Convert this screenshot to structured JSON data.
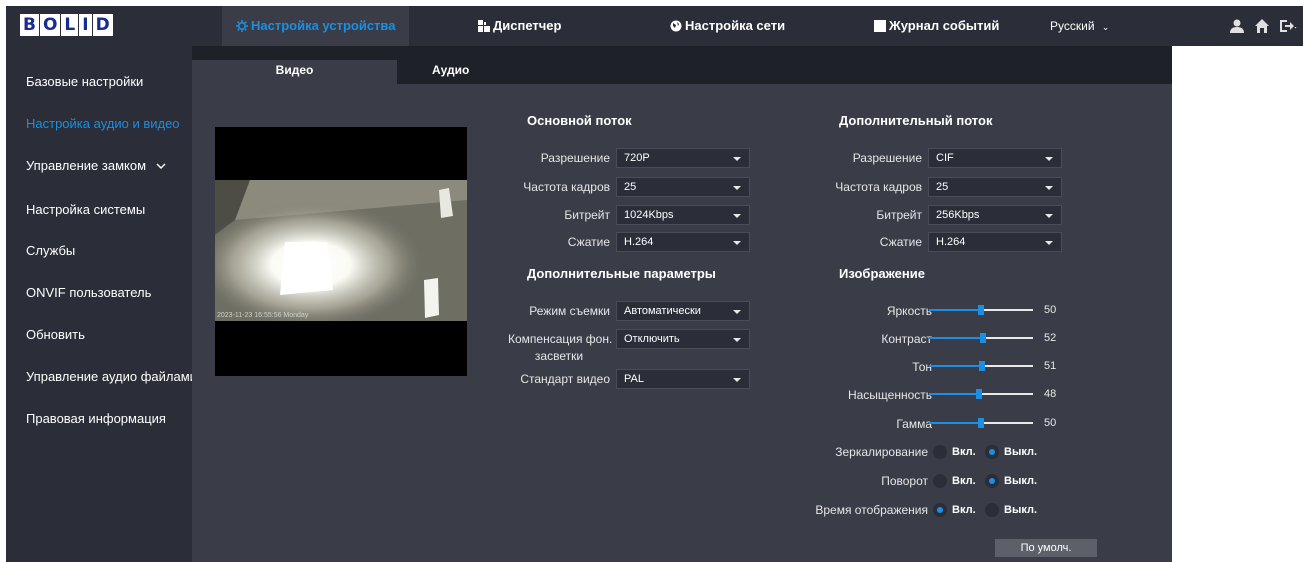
{
  "header": {
    "logo": [
      "B",
      "O",
      "L",
      "I",
      "D"
    ],
    "nav": [
      {
        "label": "Настройка устройства",
        "icon": "gear-icon",
        "active": true
      },
      {
        "label": "Диспетчер",
        "icon": "grid-icon",
        "active": false
      },
      {
        "label": "Настройка сети",
        "icon": "globe-icon",
        "active": false
      },
      {
        "label": "Журнал событий",
        "icon": "log-icon",
        "active": false
      }
    ],
    "language": "Русский",
    "icons": [
      "user-icon",
      "home-icon",
      "logout-icon"
    ]
  },
  "sidebar": {
    "items": [
      {
        "label": "Базовые настройки",
        "active": false
      },
      {
        "label": "Настройка аудио и видео",
        "active": true
      },
      {
        "label": "Управление замком",
        "active": false,
        "has_chevron": true
      },
      {
        "label": "Настройка системы",
        "active": false
      },
      {
        "label": "Службы",
        "active": false
      },
      {
        "label": "ONVIF пользователь",
        "active": false
      },
      {
        "label": "Обновить",
        "active": false
      },
      {
        "label": "Управление аудио файлами",
        "active": false
      },
      {
        "label": "Правовая информация",
        "active": false
      }
    ]
  },
  "tabs": [
    {
      "label": "Видео",
      "active": true
    },
    {
      "label": "Аудио",
      "active": false
    }
  ],
  "preview": {
    "osd_text": "2023-11-23 16:55:56 Monday"
  },
  "main_stream": {
    "title": "Основной поток",
    "fields": [
      {
        "label": "Разрешение",
        "value": "720P"
      },
      {
        "label": "Частота кадров",
        "value": "25"
      },
      {
        "label": "Битрейт",
        "value": "1024Kbps"
      },
      {
        "label": "Сжатие",
        "value": "H.264"
      }
    ]
  },
  "sub_stream": {
    "title": "Дополнительный поток",
    "fields": [
      {
        "label": "Разрешение",
        "value": "CIF"
      },
      {
        "label": "Частота кадров",
        "value": "25"
      },
      {
        "label": "Битрейт",
        "value": "256Kbps"
      },
      {
        "label": "Сжатие",
        "value": "H.264"
      }
    ]
  },
  "extra": {
    "title": "Дополнительные параметры",
    "mode_label": "Режим съемки",
    "mode_value": "Автоматически",
    "blc_label_1": "Компенсация фон.",
    "blc_label_2": "засветки",
    "blc_value": "Отключить",
    "standard_label": "Стандарт видео",
    "standard_value": "PAL"
  },
  "image": {
    "title": "Изображение",
    "sliders": [
      {
        "label": "Яркость",
        "value": 50
      },
      {
        "label": "Контраст",
        "value": 52
      },
      {
        "label": "Тон",
        "value": 51
      },
      {
        "label": "Насыщенность",
        "value": 48
      },
      {
        "label": "Гамма",
        "value": 50
      }
    ],
    "toggles": [
      {
        "label": "Зеркалирование",
        "on_label": "Вкл.",
        "off_label": "Выкл.",
        "value": "off"
      },
      {
        "label": "Поворот",
        "on_label": "Вкл.",
        "off_label": "Выкл.",
        "value": "off"
      },
      {
        "label": "Время отображения",
        "on_label": "Вкл.",
        "off_label": "Выкл.",
        "value": "on"
      }
    ],
    "default_button": "По умолч."
  },
  "colors": {
    "accent": "#1a8fe3",
    "panel": "#3a3d48",
    "bar": "#2b2e38"
  }
}
